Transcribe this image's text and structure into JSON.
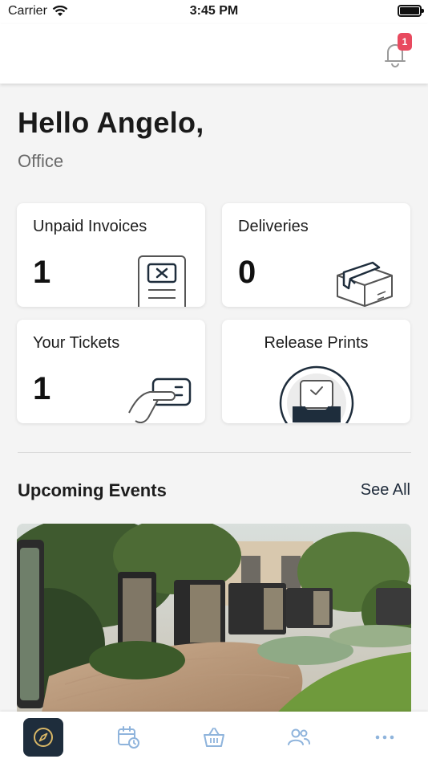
{
  "status_bar": {
    "carrier": "Carrier",
    "time": "3:45 PM"
  },
  "header": {
    "notification_count": "1"
  },
  "greeting": {
    "title": "Hello Angelo,",
    "subtitle": "Office"
  },
  "cards": {
    "unpaid_invoices": {
      "title": "Unpaid Invoices",
      "count": "1"
    },
    "deliveries": {
      "title": "Deliveries",
      "count": "0"
    },
    "tickets": {
      "title": "Your Tickets",
      "count": "1"
    },
    "release_prints": {
      "title": "Release Prints"
    }
  },
  "events": {
    "title": "Upcoming Events",
    "see_all": "See All"
  },
  "tab_bar": {
    "items": [
      {
        "icon": "compass-icon",
        "active": true
      },
      {
        "icon": "calendar-clock-icon",
        "active": false
      },
      {
        "icon": "basket-icon",
        "active": false
      },
      {
        "icon": "people-icon",
        "active": false
      },
      {
        "icon": "more-icon",
        "active": false
      }
    ]
  },
  "colors": {
    "accent_dark": "#1e2d3c",
    "badge": "#e84a5f",
    "icon_blue": "#8fb4dc"
  }
}
